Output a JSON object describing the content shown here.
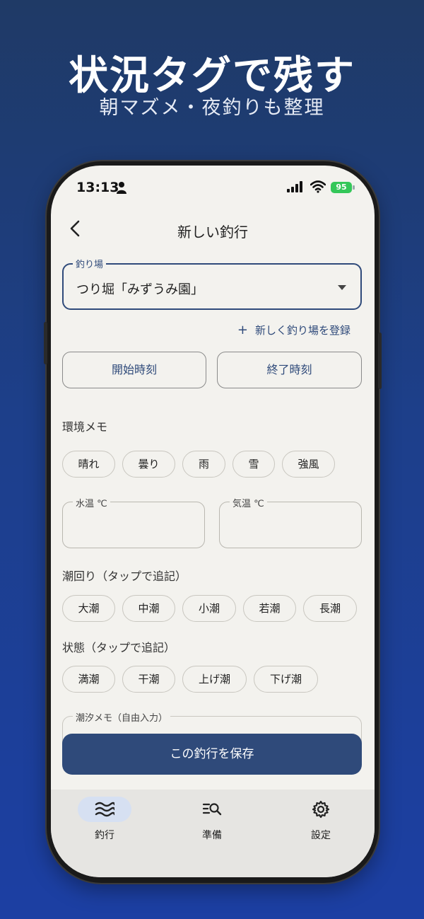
{
  "promo": {
    "headline": "状況タグで残す",
    "subline": "朝マズメ・夜釣りも整理"
  },
  "status_bar": {
    "time": "13:13",
    "battery": "95"
  },
  "app_bar": {
    "title": "新しい釣行"
  },
  "spot_select": {
    "label": "釣り場",
    "value": "つり堀「みずうみ園」"
  },
  "add_spot_link": "新しく釣り場を登録",
  "time_buttons": {
    "start": "開始時刻",
    "end": "終了時刻"
  },
  "environment": {
    "label": "環境メモ",
    "chips": [
      "晴れ",
      "曇り",
      "雨",
      "雪",
      "強風"
    ]
  },
  "water_temp": {
    "label": "水温 ℃"
  },
  "air_temp": {
    "label": "気温 ℃"
  },
  "tide_cycle": {
    "label": "潮回り（タップで追記）",
    "chips": [
      "大潮",
      "中潮",
      "小潮",
      "若潮",
      "長潮"
    ]
  },
  "tide_state": {
    "label": "状態（タップで追記）",
    "chips": [
      "満潮",
      "干潮",
      "上げ潮",
      "下げ潮"
    ]
  },
  "tide_memo": {
    "label": "潮汐メモ（自由入力）"
  },
  "save_button": "この釣行を保存",
  "tabs": [
    {
      "label": "釣行",
      "icon": "waves-icon",
      "active": true
    },
    {
      "label": "準備",
      "icon": "list-search-icon",
      "active": false
    },
    {
      "label": "設定",
      "icon": "gear-icon",
      "active": false
    }
  ],
  "colors": {
    "primary": "#2f4a7a",
    "background": "#f3f2ee",
    "battery": "#34c759"
  }
}
